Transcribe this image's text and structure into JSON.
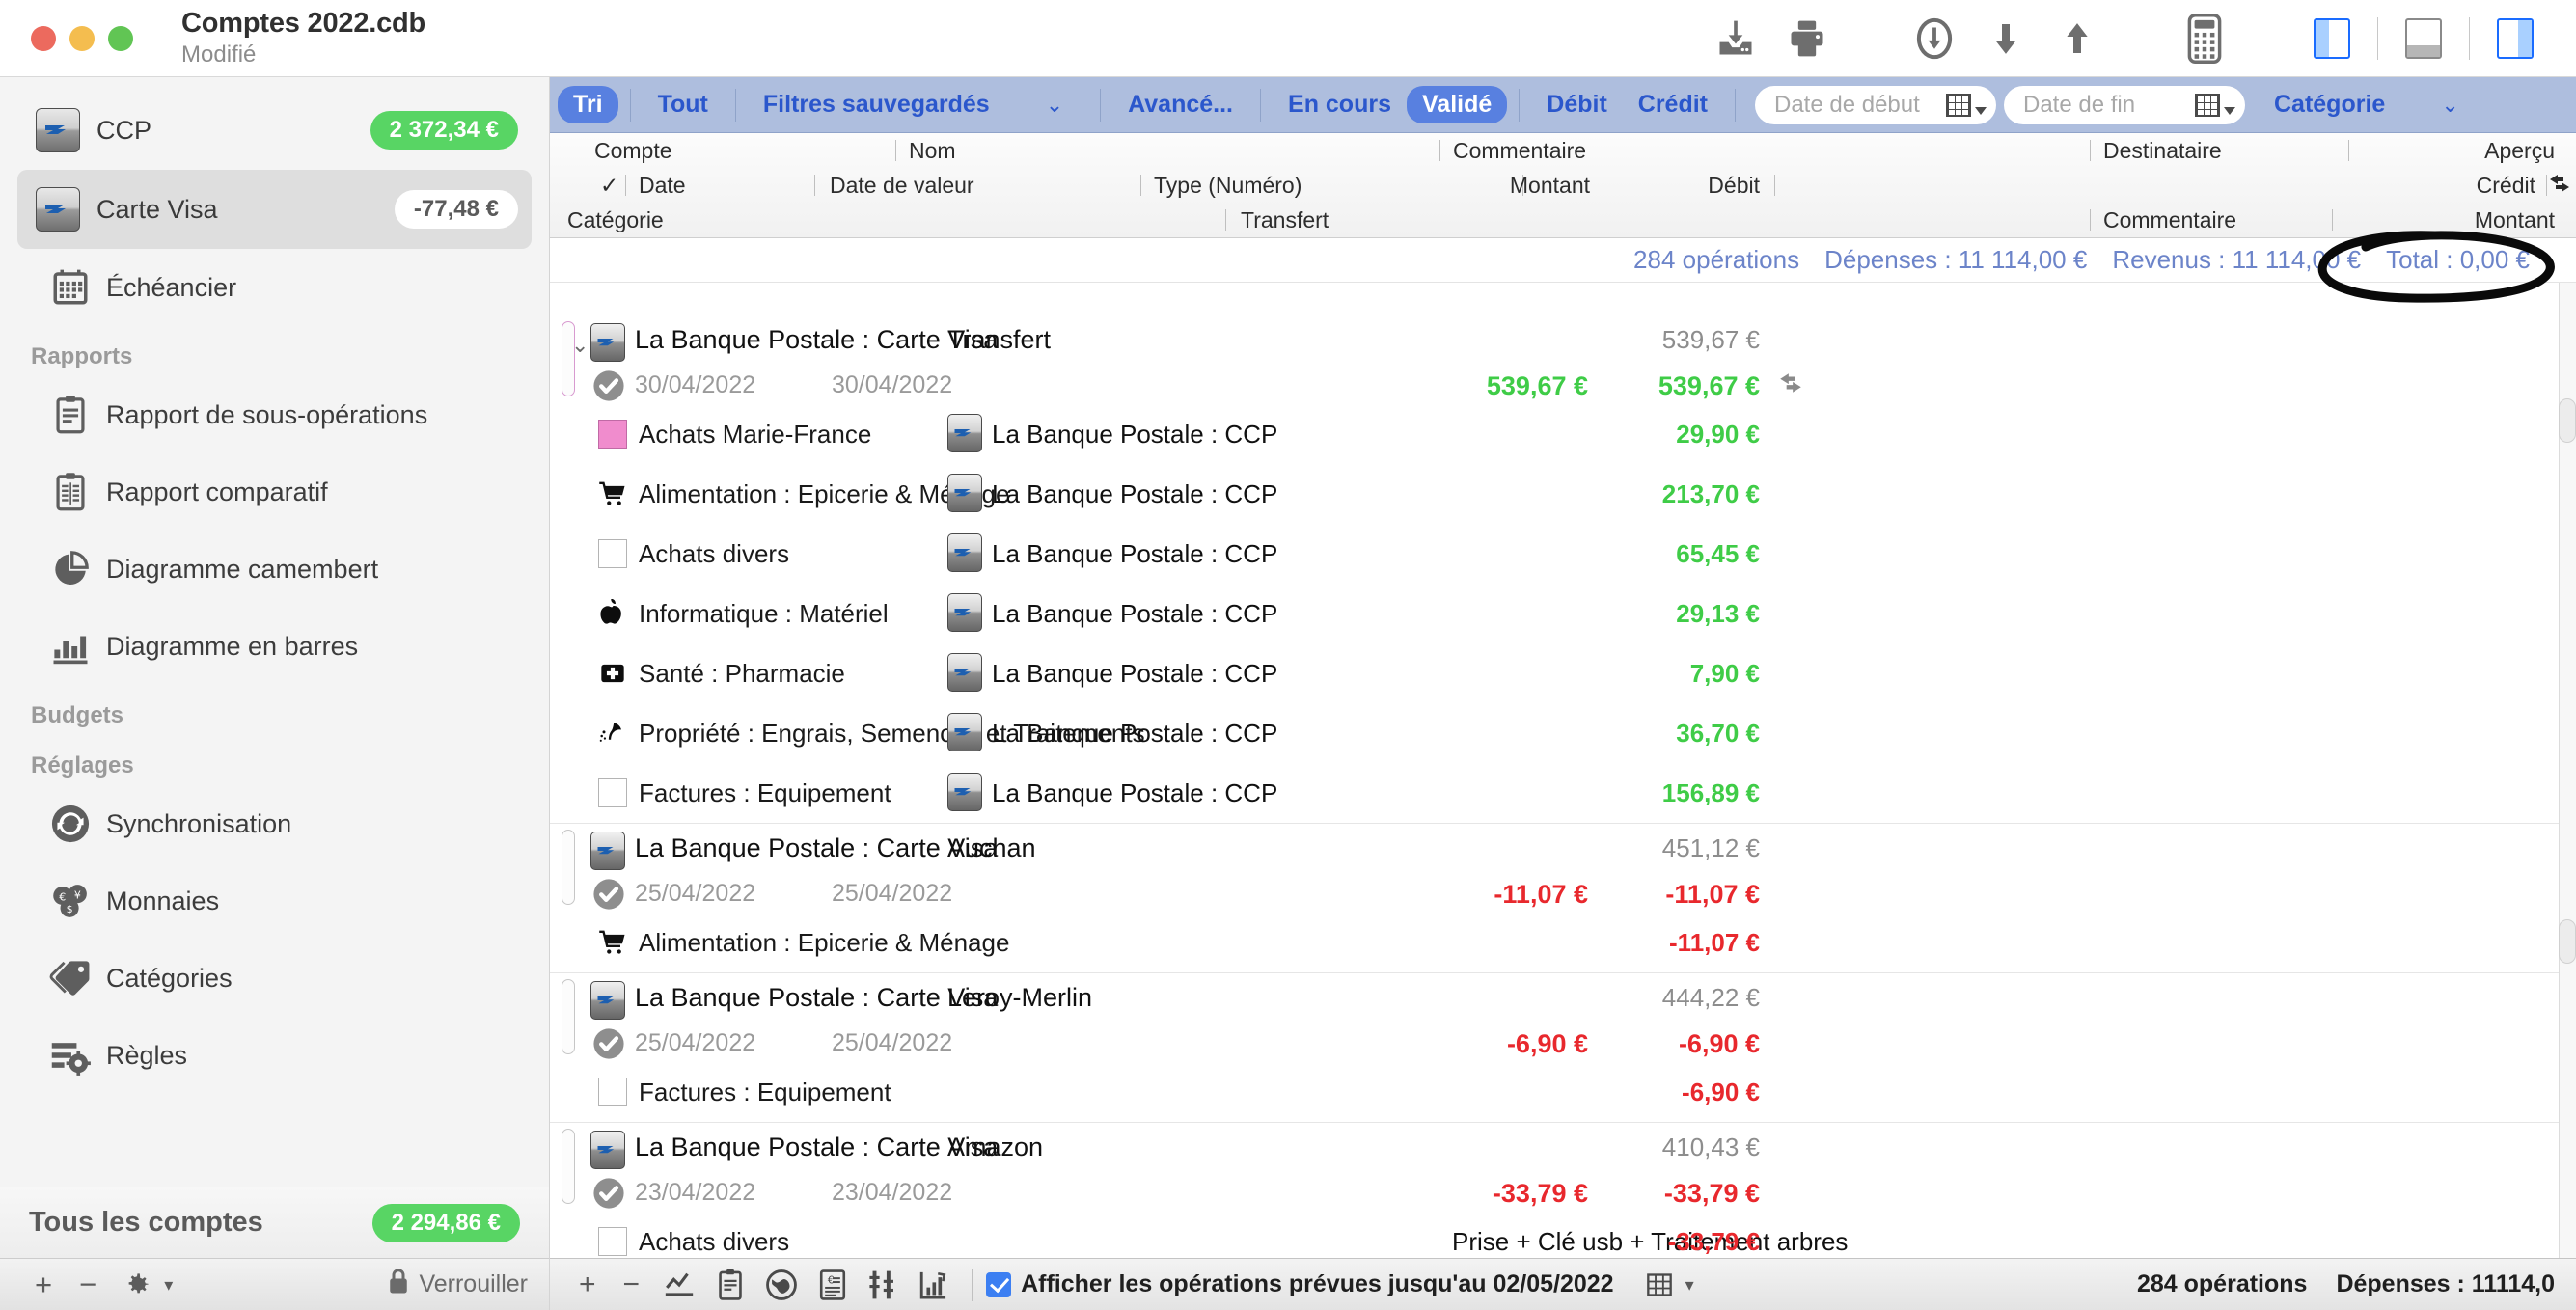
{
  "window": {
    "title": "Comptes 2022.cdb",
    "subtitle": "Modifié"
  },
  "toolbar": {
    "icons": [
      {
        "name": "import-icon",
        "label": "Importer"
      },
      {
        "name": "print-icon",
        "label": "Imprimer"
      },
      {
        "name": "download-circle-icon",
        "label": "Télécharger"
      },
      {
        "name": "arrow-down-icon",
        "label": "Descendre"
      },
      {
        "name": "arrow-up-icon",
        "label": "Monter"
      },
      {
        "name": "calculator-icon",
        "label": "Calculatrice"
      },
      {
        "name": "left-panel-icon",
        "label": "Panneau gauche"
      },
      {
        "name": "bottom-panel-icon",
        "label": "Panneau bas"
      },
      {
        "name": "right-panel-icon",
        "label": "Panneau droit"
      }
    ]
  },
  "sidebar": {
    "accounts": [
      {
        "name": "CCP",
        "balance": "2 372,34 €",
        "selected": false,
        "badge_style": "green"
      },
      {
        "name": "Carte Visa",
        "balance": "-77,48 €",
        "selected": true,
        "badge_style": "white"
      }
    ],
    "scheduler": {
      "label": "Échéancier",
      "icon": "calendar-icon"
    },
    "groups": [
      {
        "title": "Rapports",
        "items": [
          {
            "label": "Rapport de sous-opérations",
            "icon": "clipboard-list-icon"
          },
          {
            "label": "Rapport comparatif",
            "icon": "clipboard-compare-icon"
          },
          {
            "label": "Diagramme camembert",
            "icon": "pie-chart-icon"
          },
          {
            "label": "Diagramme en barres",
            "icon": "bar-chart-icon"
          }
        ]
      },
      {
        "title": "Budgets",
        "items": []
      },
      {
        "title": "Réglages",
        "items": [
          {
            "label": "Synchronisation",
            "icon": "sync-icon"
          },
          {
            "label": "Monnaies",
            "icon": "coins-icon"
          },
          {
            "label": "Catégories",
            "icon": "tag-icon"
          },
          {
            "label": "Règles",
            "icon": "rules-gear-icon"
          }
        ]
      }
    ],
    "all_accounts": {
      "label": "Tous les comptes",
      "balance": "2 294,86 €"
    },
    "bottom": {
      "add": "+",
      "remove": "−",
      "gear": "⚙",
      "gear_caret": "▾",
      "lock_label": "Verrouiller"
    }
  },
  "filterbar": {
    "sort_label": "Tri",
    "all_label": "Tout",
    "saved_filters_label": "Filtres sauvegardés",
    "saved_filters_caret": "⌄",
    "advanced_label": "Avancé...",
    "pending_label": "En cours",
    "validated_label": "Validé",
    "debit_label": "Débit",
    "credit_label": "Crédit",
    "start_date_placeholder": "Date de début",
    "end_date_placeholder": "Date de fin",
    "category_label": "Catégorie",
    "category_caret": "⌄"
  },
  "columns": {
    "row1": [
      "Compte",
      "Nom",
      "Commentaire",
      "Destinataire",
      "Aperçu"
    ],
    "row2": [
      "Date",
      "Date de valeur",
      "Type (Numéro)",
      "Montant",
      "Débit",
      "Crédit"
    ],
    "row3": [
      "Catégorie",
      "Transfert",
      "Commentaire",
      "Montant"
    ],
    "check_glyph": "✓"
  },
  "summary": {
    "operations": "284 opérations",
    "expenses": "Dépenses : 11 114,00 €",
    "income": "Revenus : 11 114,00 €",
    "total": "Total : 0,00 €",
    "disclosure": "⌄"
  },
  "transactions": [
    {
      "account": "La Banque Postale : Carte Visa",
      "name": "Transfert",
      "date": "30/04/2022",
      "value_date": "30/04/2022",
      "montant": "539,67 €",
      "debit": "539,67 €",
      "balance": "539,67 €",
      "amount_color": "green",
      "gutter": "pink",
      "transfer_icon": true,
      "suboperations": [
        {
          "category": "Achats Marie-France",
          "icon": "color-swatch-pink",
          "transfer": "La Banque Postale : CCP",
          "comment": "",
          "amount": "29,90 €",
          "color": "green"
        },
        {
          "category": "Alimentation : Epicerie & Ménage",
          "icon": "shopping-cart-icon",
          "transfer": "La Banque Postale : CCP",
          "comment": "",
          "amount": "213,70 €",
          "color": "green"
        },
        {
          "category": "Achats divers",
          "icon": "empty-square-icon",
          "transfer": "La Banque Postale : CCP",
          "comment": "",
          "amount": "65,45 €",
          "color": "green"
        },
        {
          "category": "Informatique : Matériel",
          "icon": "apple-icon",
          "transfer": "La Banque Postale : CCP",
          "comment": "",
          "amount": "29,13 €",
          "color": "green"
        },
        {
          "category": "Santé : Pharmacie",
          "icon": "medical-cross-icon",
          "transfer": "La Banque Postale : CCP",
          "comment": "",
          "amount": "7,90 €",
          "color": "green"
        },
        {
          "category": "Propriété : Engrais, Semences et Traitements",
          "icon": "plant-spray-icon",
          "transfer": "La Banque Postale : CCP",
          "comment": "",
          "amount": "36,70 €",
          "color": "green"
        },
        {
          "category": "Factures : Equipement",
          "icon": "empty-square-icon",
          "transfer": "La Banque Postale : CCP",
          "comment": "",
          "amount": "156,89 €",
          "color": "green"
        }
      ]
    },
    {
      "account": "La Banque Postale : Carte Visa",
      "name": "Auchan",
      "date": "25/04/2022",
      "value_date": "25/04/2022",
      "montant": "-11,07 €",
      "debit": "-11,07 €",
      "balance": "451,12 €",
      "amount_color": "red",
      "gutter": "plain",
      "transfer_icon": false,
      "suboperations": [
        {
          "category": "Alimentation : Epicerie & Ménage",
          "icon": "shopping-cart-icon",
          "transfer": "",
          "comment": "",
          "amount": "-11,07 €",
          "color": "red"
        }
      ]
    },
    {
      "account": "La Banque Postale : Carte Visa",
      "name": "Leroy-Merlin",
      "date": "25/04/2022",
      "value_date": "25/04/2022",
      "montant": "-6,90 €",
      "debit": "-6,90 €",
      "balance": "444,22 €",
      "amount_color": "red",
      "gutter": "plain",
      "transfer_icon": false,
      "suboperations": [
        {
          "category": "Factures : Equipement",
          "icon": "empty-square-icon",
          "transfer": "",
          "comment": "",
          "amount": "-6,90 €",
          "color": "red"
        }
      ]
    },
    {
      "account": "La Banque Postale : Carte Visa",
      "name": "Amazon",
      "date": "23/04/2022",
      "value_date": "23/04/2022",
      "montant": "-33,79 €",
      "debit": "-33,79 €",
      "balance": "410,43 €",
      "amount_color": "red",
      "gutter": "plain",
      "transfer_icon": false,
      "suboperations": [
        {
          "category": "Achats divers",
          "icon": "empty-square-icon",
          "transfer": "",
          "comment": "Prise + Clé usb + Traitement arbres",
          "amount": "-33,79 €",
          "color": "red"
        }
      ]
    }
  ],
  "bottombar": {
    "add": "+",
    "remove": "−",
    "icons": [
      {
        "name": "chart-line-icon"
      },
      {
        "name": "clipboard-icon"
      },
      {
        "name": "globe-icon"
      },
      {
        "name": "invoice-euro-icon"
      },
      {
        "name": "compare-icon"
      },
      {
        "name": "trend-up-icon"
      }
    ],
    "checkbox_label": "Afficher les opérations prévues jusqu'au 02/05/2022",
    "checkbox_checked": true,
    "grid_icon": "table-grid-icon",
    "grid_caret": "▾",
    "operations": "284 opérations",
    "expenses": "Dépenses : 11114,0"
  },
  "annotation": {
    "shape": "hand-drawn-ellipse",
    "target": "Total : 0,00 €",
    "color": "#000000"
  }
}
